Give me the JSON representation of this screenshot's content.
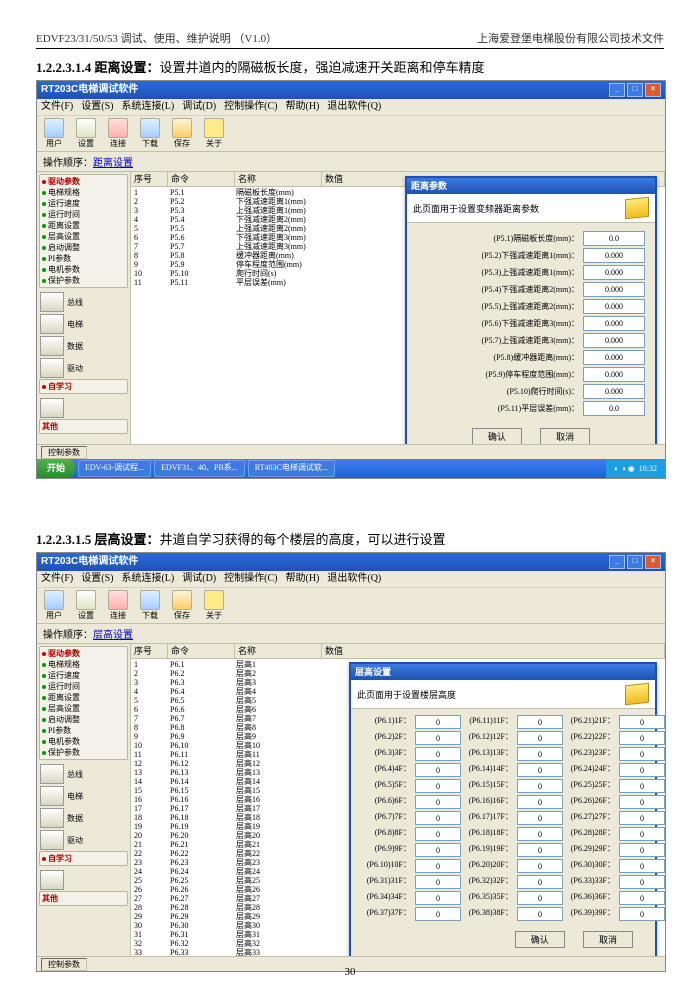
{
  "header": {
    "left": "EDVF23/31/50/53 调试、使用、维护说明  （V1.0）",
    "right": "上海爱登堡电梯股份有限公司技术文件"
  },
  "sec1": {
    "num": "1.2.2.3.1.4",
    "title": "距离设置：",
    "desc": "设置井道内的隔磁板长度，强迫减速开关距离和停车精度"
  },
  "sec2": {
    "num": "1.2.2.3.1.5",
    "title": "层高设置：",
    "desc": "井道自学习获得的每个楼层的高度，可以进行设置"
  },
  "app": {
    "title": "RT203C电梯调试软件",
    "menus": [
      "文件(F)",
      "设置(S)",
      "系统连接(L)",
      "调试(D)",
      "控制操作(C)",
      "帮助(H)",
      "退出软件(Q)"
    ],
    "tb": [
      {
        "lbl": "用户",
        "cls": "blue"
      },
      {
        "lbl": "设置",
        "cls": ""
      },
      {
        "lbl": "连接",
        "cls": "red"
      },
      {
        "lbl": "下载",
        "cls": "blue"
      },
      {
        "lbl": "保存",
        "cls": "orange"
      },
      {
        "lbl": "关于",
        "cls": "warn"
      }
    ],
    "crumb1": "距离设置",
    "crumb2": "层高设置",
    "crumb_lead": "操作顺序：",
    "side": {
      "grp1": {
        "title": "驱动参数",
        "items": [
          "电梯规格",
          "运行速度",
          "运行时间",
          "距离设置",
          "层高设置",
          "启动调整",
          "PI参数",
          "电机参数",
          "保护参数"
        ]
      },
      "icons": [
        "总线",
        "电梯",
        "数据",
        "驱动"
      ],
      "grp2": {
        "title": "自学习",
        "items": [
          ""
        ]
      },
      "grp3": {
        "title": "其他",
        "items": [
          ""
        ]
      }
    },
    "list_hdr": [
      "序号",
      "命令",
      "名称",
      "数值"
    ],
    "list1": [
      [
        "1",
        "P5.1",
        "隔磁板长度(mm)",
        ""
      ],
      [
        "2",
        "P5.2",
        "下强减速距离1(mm)",
        ""
      ],
      [
        "3",
        "P5.3",
        "上强减速距离1(mm)",
        ""
      ],
      [
        "4",
        "P5.4",
        "下强减速距离2(mm)",
        ""
      ],
      [
        "5",
        "P5.5",
        "上强减速距离2(mm)",
        ""
      ],
      [
        "6",
        "P5.6",
        "下强减速距离3(mm)",
        ""
      ],
      [
        "7",
        "P5.7",
        "上强减速距离3(mm)",
        ""
      ],
      [
        "8",
        "P5.8",
        "缓冲器距离(mm)",
        ""
      ],
      [
        "9",
        "P5.9",
        "停车程度范围(mm)",
        ""
      ],
      [
        "10",
        "P5.10",
        "爬行时间(s)",
        ""
      ],
      [
        "11",
        "P5.11",
        "平层误差(mm)",
        ""
      ]
    ],
    "list2_count": 39,
    "dlg1": {
      "title": "距离参数",
      "banner": "此页面用于设置变频器距离参数",
      "rows": [
        {
          "lbl": "(P5.1)隔磁板长度(mm)：",
          "val": "0.0"
        },
        {
          "lbl": "(P5.2)下强减速距离1(mm)：",
          "val": "0.000"
        },
        {
          "lbl": "(P5.3)上强减速距离1(mm)：",
          "val": "0.000"
        },
        {
          "lbl": "(P5.4)下强减速距离2(mm)：",
          "val": "0.000"
        },
        {
          "lbl": "(P5.5)上强减速距离2(mm)：",
          "val": "0.000"
        },
        {
          "lbl": "(P5.6)下强减速距离3(mm)：",
          "val": "0.000"
        },
        {
          "lbl": "(P5.7)上强减速距离3(mm)：",
          "val": "0.000"
        },
        {
          "lbl": "(P5.8)缓冲器距离(mm)：",
          "val": "0.000"
        },
        {
          "lbl": "(P5.9)停车程度范围(mm)：",
          "val": "0.000"
        },
        {
          "lbl": "(P5.10)爬行时间(s)：",
          "val": "0.000"
        },
        {
          "lbl": "(P5.11)平层误差(mm)：",
          "val": "0.0"
        }
      ],
      "ok": "确认",
      "cancel": "取消"
    },
    "dlg2": {
      "title": "层高设置",
      "banner": "此页面用于设置楼层高度",
      "labels": [
        "(P6.1)1F：",
        "(P6.11)11F：",
        "(P6.21)21F：",
        "(P6.2)2F：",
        "(P6.12)12F：",
        "(P6.22)22F：",
        "(P6.3)3F：",
        "(P6.13)13F：",
        "(P6.23)23F：",
        "(P6.4)4F：",
        "(P6.14)14F：",
        "(P6.24)24F：",
        "(P6.5)5F：",
        "(P6.15)15F：",
        "(P6.25)25F：",
        "(P6.6)6F：",
        "(P6.16)16F：",
        "(P6.26)26F：",
        "(P6.7)7F：",
        "(P6.17)17F：",
        "(P6.27)27F：",
        "(P6.8)8F：",
        "(P6.18)18F：",
        "(P6.28)28F：",
        "(P6.9)9F：",
        "(P6.19)19F：",
        "(P6.29)29F：",
        "(P6.10)10F：",
        "(P6.20)20F：",
        "(P6.30)30F：",
        "(P6.31)31F：",
        "(P6.32)32F：",
        "(P6.33)33F：",
        "(P6.34)34F：",
        "(P6.35)35F：",
        "(P6.36)36F：",
        "(P6.37)37F：",
        "(P6.38)38F：",
        "(P6.39)39F："
      ],
      "val": "0",
      "ok": "确认",
      "cancel": "取消"
    },
    "status": "控制参数",
    "tasks": [
      "开始",
      "EDV-63-调试程...",
      "EDVF31、40、PB系...",
      "RT403C电梯调试软..."
    ],
    "tray_time": "16:32"
  },
  "pagenum": "30"
}
